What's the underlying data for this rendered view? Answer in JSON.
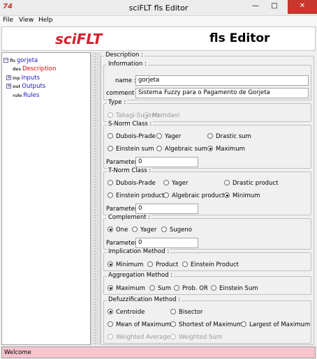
{
  "window": {
    "title": "sciFLT fls Editor",
    "icon_text": "74",
    "minimize": "—",
    "maximize": "□",
    "close": "✕"
  },
  "menu": [
    "File",
    "View",
    "Help"
  ],
  "banner": {
    "logo": "sciFLT",
    "title": "fls Editor"
  },
  "tree": {
    "root": {
      "label": "gorjeta",
      "icon": "fls"
    },
    "items": [
      {
        "label": "Description",
        "icon": "des",
        "selected": true
      },
      {
        "label": "Inputs",
        "icon": "inp"
      },
      {
        "label": "Outputs",
        "icon": "out"
      },
      {
        "label": "Rules",
        "icon": "rule"
      }
    ]
  },
  "description": {
    "legend": "Description :",
    "information": {
      "legend": "Information :",
      "name_label": "name :",
      "name_value": "gorjeta",
      "comment_label": "comment :",
      "comment_value": "Sistema Fuzzy para o Pagamento de Gorjeta"
    },
    "type": {
      "legend": "Type :",
      "options": [
        "Takagi-Sugeno",
        "Mamdani"
      ],
      "selected": "Mamdani"
    },
    "snorm": {
      "legend": "S-Norm Class :",
      "options": [
        "Dubois-Prade",
        "Yager",
        "Drastic sum",
        "Einstein sum",
        "Algebraic sum",
        "Maximum"
      ],
      "selected": "Maximum",
      "parameter_label": "Parameter :",
      "parameter_value": "0"
    },
    "tnorm": {
      "legend": "T-Norm Class :",
      "options": [
        "Dubois-Prade",
        "Yager",
        "Drastic product",
        "Einstein product",
        "Algebraic product",
        "Minimum"
      ],
      "selected": "Minimum",
      "parameter_label": "Parameter :",
      "parameter_value": "0"
    },
    "complement": {
      "legend": "Complement :",
      "options": [
        "One",
        "Yager",
        "Sugeno"
      ],
      "selected": "One",
      "parameter_label": "Parameter :",
      "parameter_value": "0"
    },
    "implication": {
      "legend": "Implication Method :",
      "options": [
        "Minimum",
        "Product",
        "Einstein Product"
      ],
      "selected": "Minimum"
    },
    "aggregation": {
      "legend": "Aggregation Method :",
      "options": [
        "Maximum",
        "Sum",
        "Prob. OR",
        "Einstein Sum"
      ],
      "selected": "Maximum"
    },
    "defuzz": {
      "legend": "Defuzzification Method :",
      "options": [
        "Centroide",
        "Bisector",
        "Mean of Maximum",
        "Shortest of Maximum",
        "Largest of Maximum",
        "Weighted Average",
        "Weighted Sum"
      ],
      "selected": "Centroide"
    }
  },
  "status": {
    "text": "Welcome"
  }
}
